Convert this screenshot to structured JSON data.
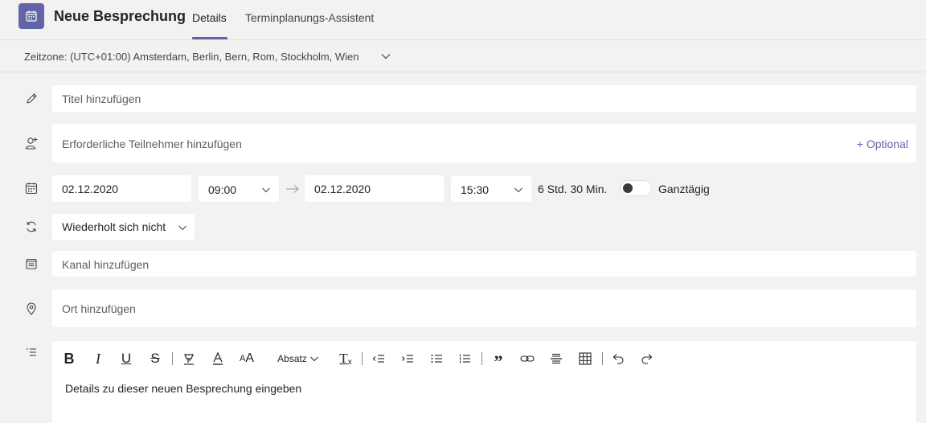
{
  "header": {
    "app_icon": "calendar-icon",
    "title": "Neue Besprechung",
    "tabs": [
      {
        "label": "Details",
        "active": true
      },
      {
        "label": "Terminplanungs-Assistent",
        "active": false
      }
    ]
  },
  "timezone": {
    "label": "Zeitzone: (UTC+01:00) Amsterdam, Berlin, Bern, Rom, Stockholm, Wien"
  },
  "form": {
    "title": {
      "icon": "pencil-icon",
      "placeholder": "Titel hinzufügen"
    },
    "attendees": {
      "icon": "add-person-icon",
      "placeholder": "Erforderliche Teilnehmer hinzufügen",
      "optional_label": "+ Optional"
    },
    "datetime": {
      "icon": "calendar-icon",
      "start_date": "02.12.2020",
      "start_time": "09:00",
      "end_date": "02.12.2020",
      "end_time": "15:30",
      "duration": "6 Std. 30 Min.",
      "all_day_label": "Ganztägig",
      "all_day_on": false
    },
    "recurrence": {
      "icon": "repeat-icon",
      "value": "Wiederholt sich nicht"
    },
    "channel": {
      "icon": "channel-icon",
      "placeholder": "Kanal hinzufügen"
    },
    "location": {
      "icon": "location-pin-icon",
      "placeholder": "Ort hinzufügen"
    },
    "details": {
      "icon": "details-list-icon",
      "paragraph_style": "Absatz",
      "placeholder": "Details zu dieser neuen Besprechung eingeben"
    }
  },
  "colors": {
    "accent": "#6264a7",
    "background": "#f3f2f1",
    "field": "#ffffff"
  }
}
